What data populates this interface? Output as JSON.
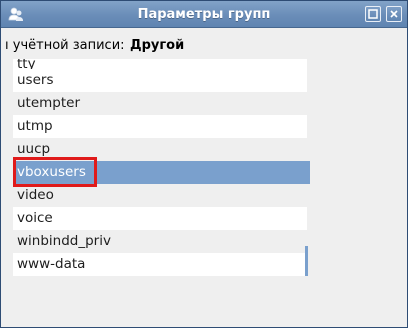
{
  "window": {
    "title": "Параметры групп"
  },
  "account": {
    "prefix": "ı учётной записи:",
    "value": "Другой"
  },
  "groups": [
    "tty",
    "users",
    "utempter",
    "utmp",
    "uucp",
    "vboxusers",
    "video",
    "voice",
    "winbindd_priv",
    "www-data"
  ],
  "selected_group": "vboxusers",
  "colors": {
    "titlebar": "#6a8db8",
    "selection": "#7aa0cd",
    "highlight_border": "#e01a1a"
  }
}
